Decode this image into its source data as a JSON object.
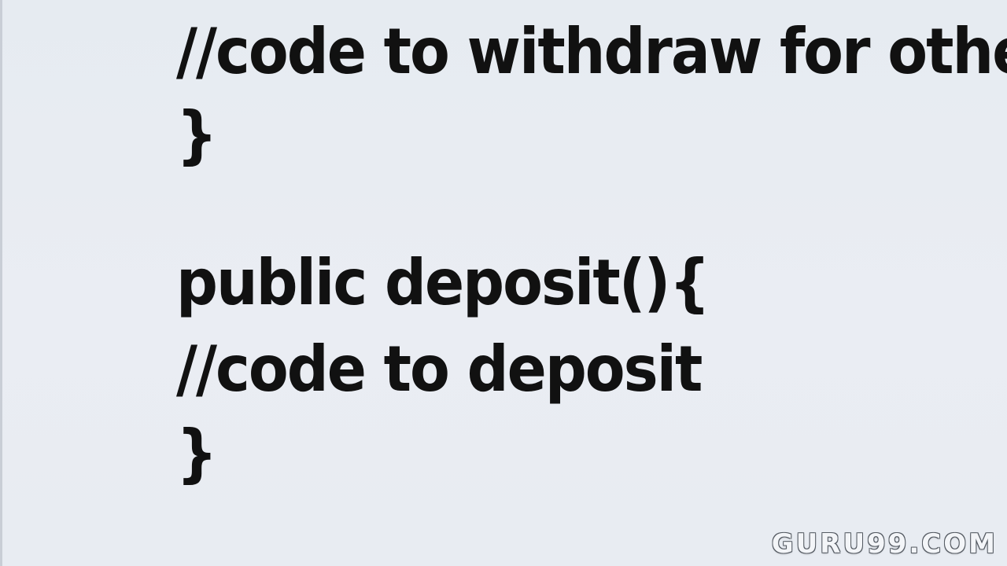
{
  "code": {
    "lines": [
      "//code to withdraw for other",
      "}",
      "public deposit(){",
      "//code to deposit",
      "}"
    ]
  },
  "watermark": "GURU99.COM",
  "colors": {
    "background": "#e9edf3",
    "text": "#111111",
    "watermark_fill": "#f3f5f8",
    "watermark_outline": "#555b63"
  }
}
